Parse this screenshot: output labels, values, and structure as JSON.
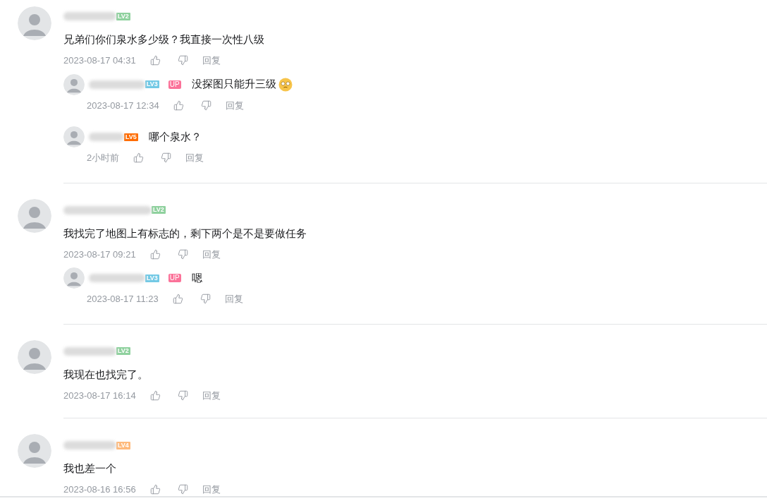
{
  "comments": [
    {
      "level": "LV2",
      "color": "#8fd19e",
      "text": "兄弟们你们泉水多少级？我直接一次性八级",
      "time": "2023-08-17 04:31",
      "reply_label": "回复",
      "replies": [
        {
          "level": "LV3",
          "color": "#73c9e5",
          "up_badge": "UP",
          "text": "没探图只能升三级",
          "emoji": true,
          "time": "2023-08-17 12:34",
          "reply_label": "回复"
        },
        {
          "level": "LV5",
          "color": "#ff6c00",
          "text": "哪个泉水？",
          "emoji": false,
          "time": "2小时前",
          "reply_label": "回复"
        }
      ]
    },
    {
      "level": "LV2",
      "color": "#8fd19e",
      "text": "我找完了地图上有标志的，剩下两个是不是要做任务",
      "time": "2023-08-17 09:21",
      "reply_label": "回复",
      "replies": [
        {
          "level": "LV3",
          "color": "#73c9e5",
          "up_badge": "UP",
          "text": "嗯",
          "emoji": false,
          "time": "2023-08-17 11:23",
          "reply_label": "回复"
        }
      ]
    },
    {
      "level": "LV2",
      "color": "#8fd19e",
      "text": "我现在也找完了。",
      "time": "2023-08-17 16:14",
      "reply_label": "回复"
    },
    {
      "level": "LV4",
      "color": "#feba7c",
      "text": "我也差一个",
      "time": "2023-08-16 16:56",
      "reply_label": "回复"
    }
  ]
}
